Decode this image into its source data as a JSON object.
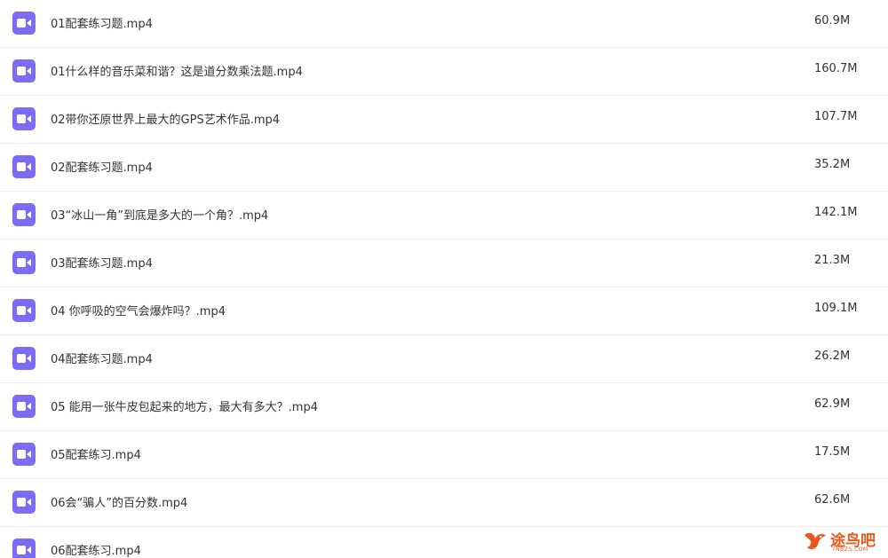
{
  "files": [
    {
      "name": "01配套练习题.mp4",
      "size": "60.9M",
      "icon": "video-file-icon"
    },
    {
      "name": "01什么样的音乐菜和谐？这是道分数乘法题.mp4",
      "size": "160.7M",
      "icon": "video-file-icon"
    },
    {
      "name": "02带你还原世界上最大的GPS艺术作品.mp4",
      "size": "107.7M",
      "icon": "video-file-icon"
    },
    {
      "name": "02配套练习题.mp4",
      "size": "35.2M",
      "icon": "video-file-icon"
    },
    {
      "name": "03“冰山一角”到底是多大的一个角？.mp4",
      "size": "142.1M",
      "icon": "video-file-icon"
    },
    {
      "name": "03配套练习题.mp4",
      "size": "21.3M",
      "icon": "video-file-icon"
    },
    {
      "name": "04 你呼吸的空气会爆炸吗？.mp4",
      "size": "109.1M",
      "icon": "video-file-icon"
    },
    {
      "name": "04配套练习题.mp4",
      "size": "26.2M",
      "icon": "video-file-icon"
    },
    {
      "name": "05 能用一张牛皮包起来的地方，最大有多大？.mp4",
      "size": "62.9M",
      "icon": "video-file-icon"
    },
    {
      "name": "05配套练习.mp4",
      "size": "17.5M",
      "icon": "video-file-icon"
    },
    {
      "name": "06会“骗人”的百分数.mp4",
      "size": "62.6M",
      "icon": "video-file-icon"
    },
    {
      "name": "06配套练习.mp4",
      "size": "",
      "icon": "video-file-icon"
    }
  ],
  "watermark": {
    "text": "途鸟吧",
    "sub": "TNBZS.COM"
  },
  "colors": {
    "icon_bg": "#7b6cf6",
    "text": "#333333",
    "divider": "#eeeeee",
    "watermark": "#e8581a"
  }
}
